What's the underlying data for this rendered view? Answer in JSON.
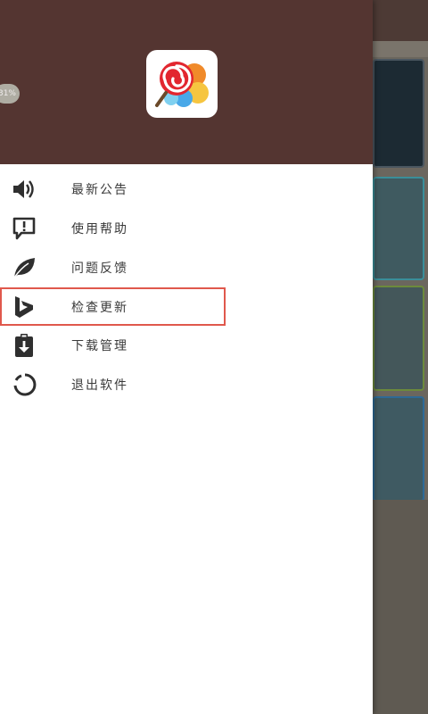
{
  "drawer": {
    "header_color": "#543531",
    "logo": "lollipop-app-logo",
    "menu": [
      {
        "label": "最新公告",
        "icon": "speaker-icon"
      },
      {
        "label": "使用帮助",
        "icon": "help-chat-icon"
      },
      {
        "label": "问题反馈",
        "icon": "leaf-feedback-icon"
      },
      {
        "label": "检查更新",
        "icon": "bing-update-icon",
        "highlighted": true
      },
      {
        "label": "下载管理",
        "icon": "clipboard-download-icon"
      },
      {
        "label": "退出软件",
        "icon": "power-circle-icon"
      }
    ]
  },
  "badge_text": "31%",
  "colors": {
    "highlight_border": "#e0584c",
    "icon_dark": "#2f2f2f"
  }
}
